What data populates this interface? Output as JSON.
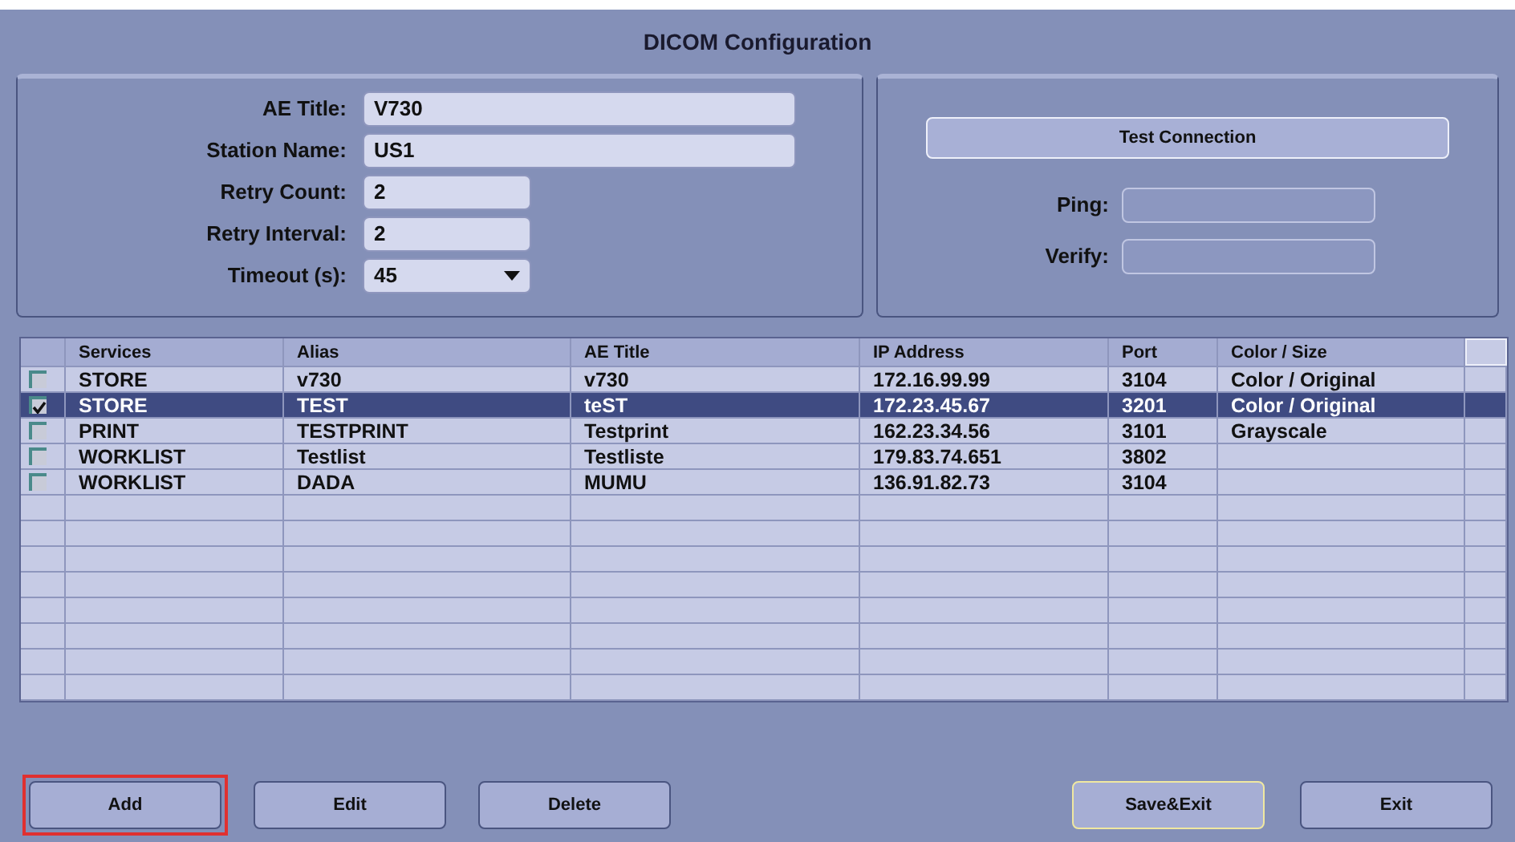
{
  "window": {
    "title": "DICOM Configuration"
  },
  "settings": [
    {
      "label": "AE Title:",
      "value": "V730",
      "kind": "wide"
    },
    {
      "label": "Station Name:",
      "value": "US1",
      "kind": "wide"
    },
    {
      "label": "Retry Count:",
      "value": "2",
      "kind": "short"
    },
    {
      "label": "Retry Interval:",
      "value": "2",
      "kind": "short"
    },
    {
      "label": "Timeout (s):",
      "value": "45",
      "kind": "dropdown"
    }
  ],
  "connection": {
    "button": "Test Connection",
    "fields": [
      {
        "label": "Ping:"
      },
      {
        "label": "Verify:"
      }
    ]
  },
  "table": {
    "columns": [
      "Services",
      "Alias",
      "AE Title",
      "IP Address",
      "Port",
      "Color / Size"
    ],
    "rows": [
      {
        "checked": false,
        "selected": false,
        "cells": [
          "STORE",
          "v730",
          "v730",
          "172.16.99.99",
          "3104",
          "Color / Original"
        ]
      },
      {
        "checked": true,
        "selected": true,
        "cells": [
          "STORE",
          "TEST",
          "teST",
          "172.23.45.67",
          "3201",
          "Color / Original"
        ]
      },
      {
        "checked": false,
        "selected": false,
        "cells": [
          "PRINT",
          "TESTPRINT",
          "Testprint",
          "162.23.34.56",
          "3101",
          "Grayscale"
        ]
      },
      {
        "checked": false,
        "selected": false,
        "cells": [
          "WORKLIST",
          "Testlist",
          "Testliste",
          "179.83.74.651",
          "3802",
          ""
        ]
      },
      {
        "checked": false,
        "selected": false,
        "cells": [
          "WORKLIST",
          "DADA",
          "MUMU",
          "136.91.82.73",
          "3104",
          ""
        ]
      }
    ]
  },
  "buttons": [
    {
      "label": "Add",
      "highlighted": true,
      "focused": false
    },
    {
      "label": "Edit",
      "highlighted": false,
      "focused": false
    },
    {
      "label": "Delete",
      "highlighted": false,
      "focused": false
    },
    {
      "label": "Save&Exit",
      "highlighted": false,
      "focused": true
    },
    {
      "label": "Exit",
      "highlighted": false,
      "focused": false
    }
  ]
}
